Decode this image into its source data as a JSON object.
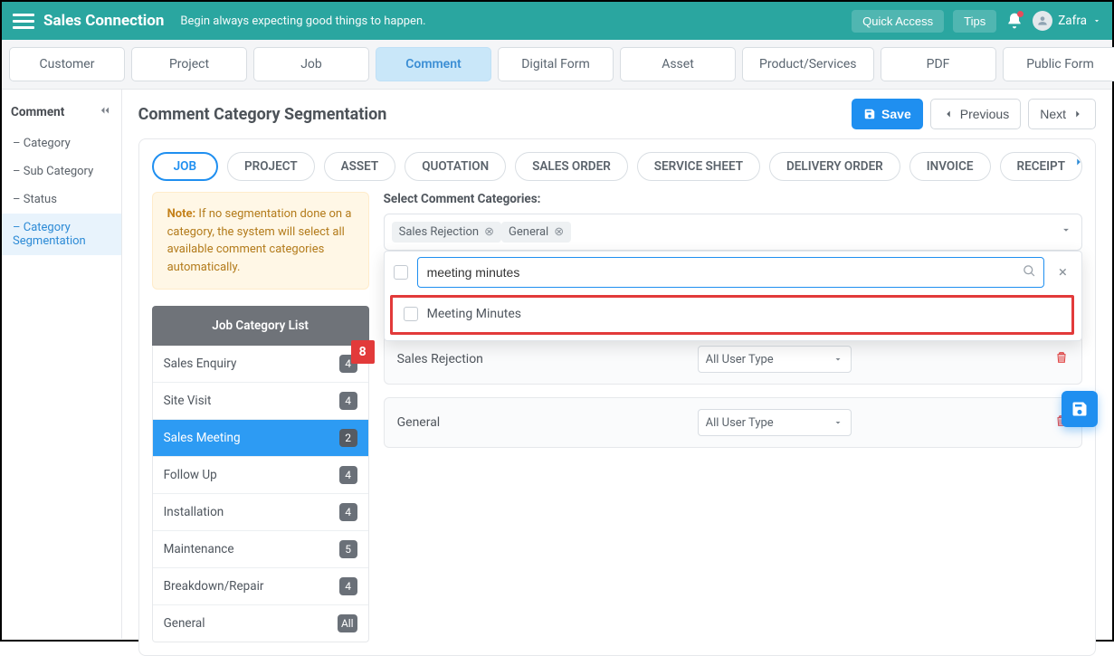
{
  "header": {
    "brand": "Sales Connection",
    "tagline": "Begin always expecting good things to happen.",
    "quick_access": "Quick Access",
    "tips": "Tips",
    "username": "Zafra"
  },
  "tabs": {
    "items": [
      "Customer",
      "Project",
      "Job",
      "Comment",
      "Digital Form",
      "Asset",
      "Product/Services",
      "PDF",
      "Public Form"
    ],
    "active_index": 3
  },
  "sidebar": {
    "title": "Comment",
    "items": [
      {
        "label": "– Category"
      },
      {
        "label": "– Sub Category"
      },
      {
        "label": "– Status"
      },
      {
        "label": "– Category Segmentation",
        "active": true
      }
    ]
  },
  "page": {
    "title": "Comment Category Segmentation",
    "save": "Save",
    "previous": "Previous",
    "next": "Next"
  },
  "seg_pills": {
    "items": [
      "JOB",
      "PROJECT",
      "ASSET",
      "QUOTATION",
      "SALES ORDER",
      "SERVICE SHEET",
      "DELIVERY ORDER",
      "INVOICE",
      "RECEIPT"
    ],
    "active_index": 0
  },
  "note": {
    "prefix": "Note:",
    "body": " If no segmentation done on a category, the system will select all available comment categories automatically."
  },
  "catlist": {
    "title": "Job Category List",
    "items": [
      {
        "label": "Sales Enquiry",
        "badge": "4"
      },
      {
        "label": "Site Visit",
        "badge": "4"
      },
      {
        "label": "Sales Meeting",
        "badge": "2",
        "active": true
      },
      {
        "label": "Follow Up",
        "badge": "4"
      },
      {
        "label": "Installation",
        "badge": "4"
      },
      {
        "label": "Maintenance",
        "badge": "5"
      },
      {
        "label": "Breakdown/Repair",
        "badge": "4"
      },
      {
        "label": "General",
        "badge": "All"
      }
    ]
  },
  "select_section": {
    "label": "Select Comment Categories:",
    "chips": [
      "Sales Rejection",
      "General"
    ],
    "search_value": "meeting minutes",
    "dropdown_option": "Meeting Minutes",
    "step_num": "8"
  },
  "assigned_rows": [
    {
      "name": "Sales Rejection",
      "user_type": "All User Type"
    },
    {
      "name": "General",
      "user_type": "All User Type"
    }
  ]
}
